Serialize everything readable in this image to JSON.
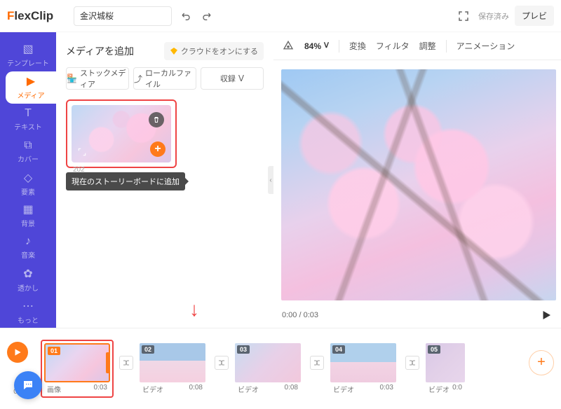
{
  "header": {
    "logo_prefix": "F",
    "logo_rest": "lexClip",
    "project_title": "金沢城桜",
    "saved_label": "保存済み",
    "preview_label": "プレビ"
  },
  "sidebar": {
    "items": [
      {
        "label": "テンプレート",
        "icon": "template-icon"
      },
      {
        "label": "メディア",
        "icon": "media-icon"
      },
      {
        "label": "テキスト",
        "icon": "text-icon"
      },
      {
        "label": "カバー",
        "icon": "cover-icon"
      },
      {
        "label": "要素",
        "icon": "elements-icon"
      },
      {
        "label": "背景",
        "icon": "background-icon"
      },
      {
        "label": "音楽",
        "icon": "music-icon"
      },
      {
        "label": "透かし",
        "icon": "watermark-icon"
      },
      {
        "label": "もっと",
        "icon": "more-icon"
      }
    ],
    "active_index": 1
  },
  "media_panel": {
    "title": "メディアを追加",
    "cloud_label": "クラウドをオンにする",
    "tabs": {
      "stock": "ストックメディア",
      "local": "ローカルファイル",
      "record": "収録"
    },
    "thumb": {
      "year": "202",
      "tooltip": "現在のストーリーボードに追加"
    }
  },
  "toolbar": {
    "zoom": "84%",
    "items": [
      "変換",
      "フィルタ",
      "調整",
      "アニメーション"
    ]
  },
  "player": {
    "time": "0:00 / 0:03"
  },
  "timeline": {
    "total": "0:29",
    "clips": [
      {
        "num": "01",
        "type": "画像",
        "dur": "0:03"
      },
      {
        "num": "02",
        "type": "ビデオ",
        "dur": "0:08"
      },
      {
        "num": "03",
        "type": "ビデオ",
        "dur": "0:08"
      },
      {
        "num": "04",
        "type": "ビデオ",
        "dur": "0:03"
      },
      {
        "num": "05",
        "type": "ビデオ",
        "dur": "0:0"
      }
    ]
  }
}
